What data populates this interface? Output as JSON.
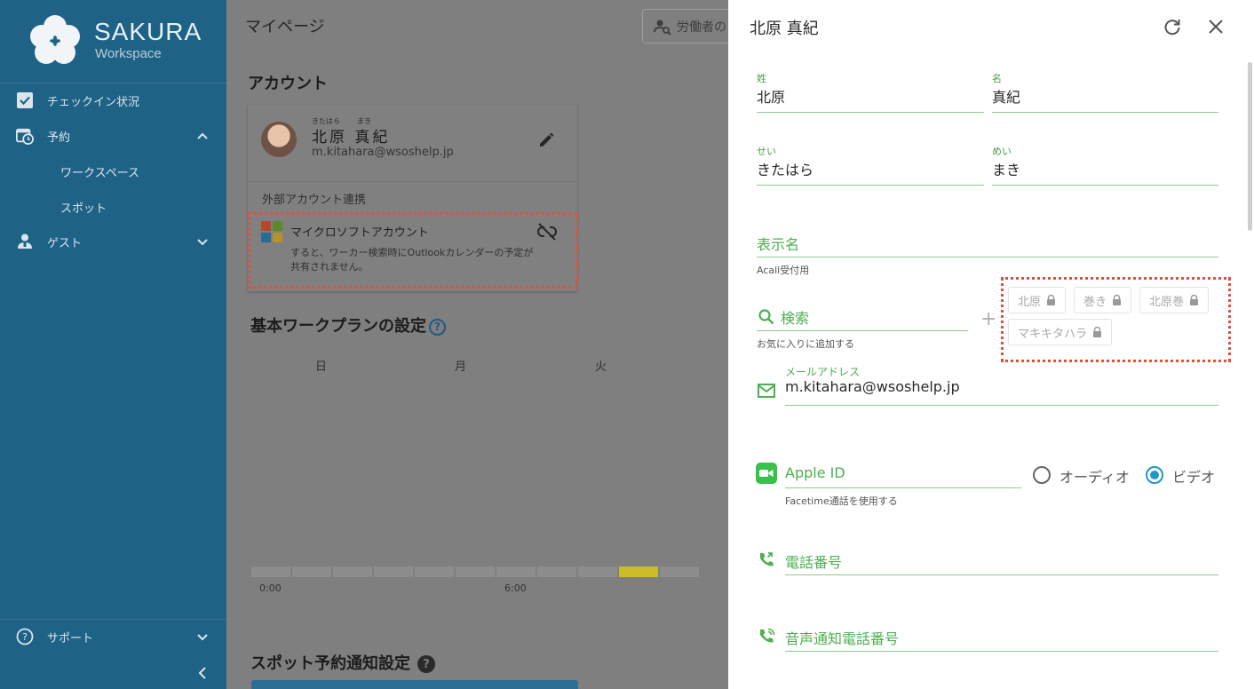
{
  "brand": {
    "name": "SAKURA",
    "sub": "Workspace"
  },
  "sidebar": {
    "items": [
      {
        "label": "チェックイン状況",
        "icon": "checkbox-icon"
      },
      {
        "label": "予約",
        "icon": "calendar-clock-icon"
      },
      {
        "label": "ワークスペース"
      },
      {
        "label": "スポット"
      },
      {
        "label": "ゲスト",
        "icon": "guest-icon"
      }
    ],
    "support": "サポート"
  },
  "main": {
    "title": "マイページ",
    "search_placeholder": "労働者の",
    "account_heading": "アカウント",
    "account": {
      "ruby_last": "きたはら",
      "ruby_first": "まき",
      "name": "北原 真紀",
      "email": "m.kitahara@wsoshelp.jp",
      "external_label": "外部アカウント連携",
      "ms_label": "マイクロソフトアカウント",
      "ms_note": "すると、ワーカー検索時にOutlookカレンダーの予定が共有されません。"
    },
    "workplan_heading": "基本ワークプランの設定",
    "days": [
      "日",
      "月",
      "火"
    ],
    "times": [
      "0:00",
      "6:00"
    ],
    "timeline_active_slot": 9,
    "spot_heading": "スポット予約通知設定"
  },
  "panel": {
    "title": "北原 真紀",
    "last_name": {
      "caption": "姓",
      "value": "北原"
    },
    "first_name": {
      "caption": "名",
      "value": "真紀"
    },
    "last_kana": {
      "caption": "せい",
      "value": "きたはら"
    },
    "first_kana": {
      "caption": "めい",
      "value": "まき"
    },
    "display_name": {
      "label": "表示名",
      "hint": "Acall受付用"
    },
    "search": {
      "label": "検索",
      "hint": "お気に入りに追加する"
    },
    "chips": [
      "北原",
      "巻き",
      "北原巻",
      "マキキタハラ"
    ],
    "email": {
      "caption": "メールアドレス",
      "value": "m.kitahara@wsoshelp.jp"
    },
    "apple": {
      "label": "Apple ID",
      "hint": "Facetime通話を使用する",
      "audio": "オーディオ",
      "video": "ビデオ"
    },
    "phone": {
      "label": "電話番号"
    },
    "voice_phone": {
      "label": "音声通知電話番号"
    }
  },
  "colors": {
    "sidebar": "#1e6286",
    "accent_green": "#4caf50",
    "highlight": "#e04f3d",
    "radio": "#2196c9"
  }
}
